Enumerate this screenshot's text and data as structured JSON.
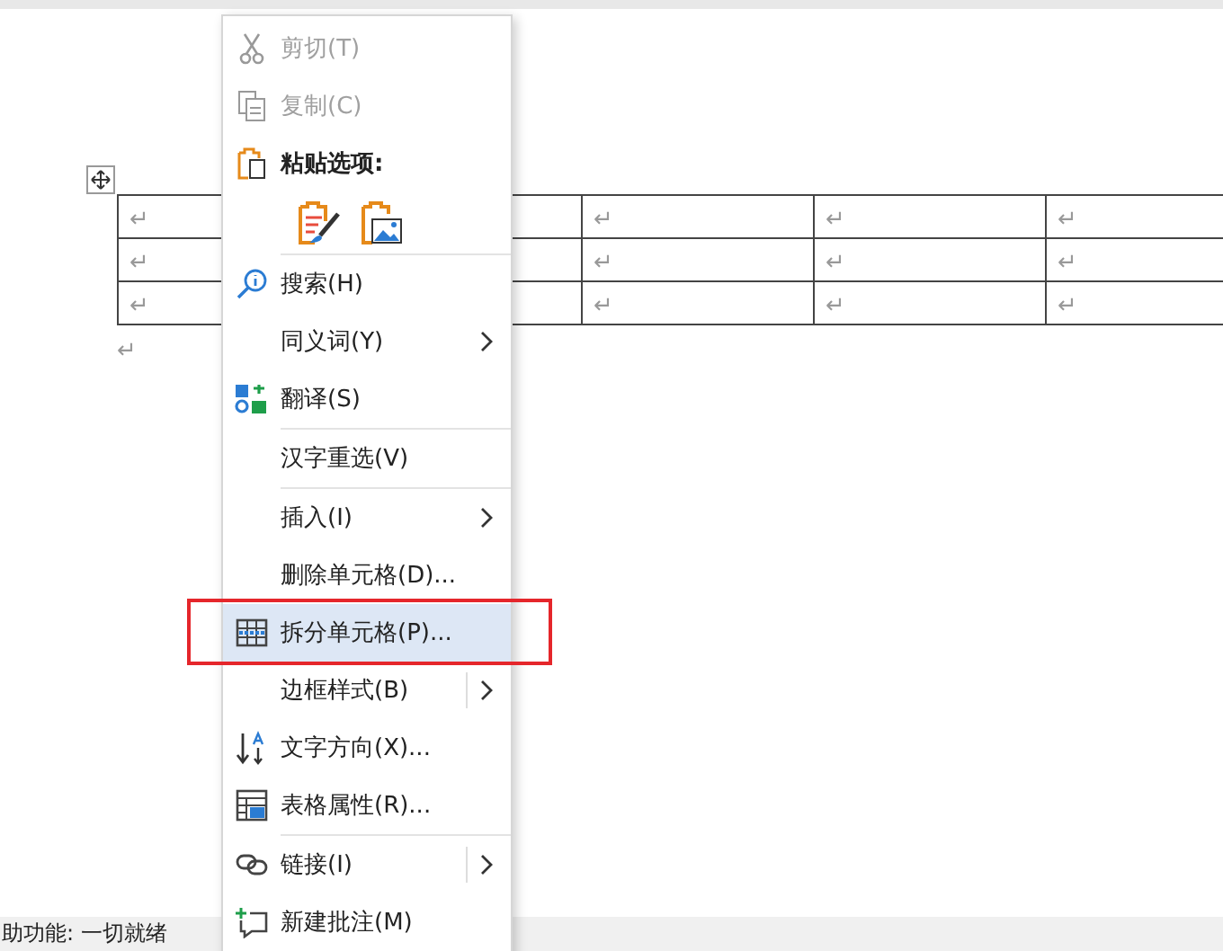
{
  "table": {
    "rows": [
      {
        "cells": [
          {
            "text": "↵"
          },
          {},
          {
            "text": "↵"
          },
          {
            "text": "↵"
          },
          {
            "text": "↵"
          }
        ]
      },
      {
        "cells": [
          {
            "text": "↵"
          },
          {},
          {
            "text": "↵"
          },
          {
            "text": "↵"
          },
          {
            "text": "↵"
          }
        ]
      },
      {
        "cells": [
          {
            "text": "↵"
          },
          {},
          {
            "text": "↵"
          },
          {
            "text": "↵"
          },
          {
            "text": "↵"
          }
        ]
      }
    ]
  },
  "paragraph_mark": "↵",
  "context_menu": {
    "items": [
      {
        "kind": "item",
        "label": "剪切(T)",
        "disabled": true,
        "submenu": false,
        "selected": false
      },
      {
        "kind": "item",
        "label": "复制(C)",
        "disabled": true,
        "submenu": false,
        "selected": false
      },
      {
        "kind": "header",
        "label": "粘贴选项:"
      },
      {
        "kind": "paste"
      },
      {
        "kind": "separator"
      },
      {
        "kind": "item",
        "label": "搜索(H)",
        "disabled": false,
        "submenu": false,
        "selected": false
      },
      {
        "kind": "item",
        "label": "同义词(Y)",
        "disabled": false,
        "submenu": true,
        "selected": false
      },
      {
        "kind": "item",
        "label": "翻译(S)",
        "disabled": false,
        "submenu": false,
        "selected": false
      },
      {
        "kind": "separator"
      },
      {
        "kind": "item",
        "label": "汉字重选(V)",
        "disabled": false,
        "submenu": false,
        "selected": false
      },
      {
        "kind": "separator"
      },
      {
        "kind": "item",
        "label": "插入(I)",
        "disabled": false,
        "submenu": true,
        "selected": false
      },
      {
        "kind": "item",
        "label": "删除单元格(D)...",
        "disabled": false,
        "submenu": false,
        "selected": false
      },
      {
        "kind": "item",
        "label": "拆分单元格(P)...",
        "disabled": false,
        "submenu": false,
        "selected": true,
        "annotated": true
      },
      {
        "kind": "item",
        "label": "边框样式(B)",
        "disabled": false,
        "submenu": true,
        "split": true,
        "selected": false
      },
      {
        "kind": "item",
        "label": "文字方向(X)...",
        "disabled": false,
        "submenu": false,
        "selected": false
      },
      {
        "kind": "item",
        "label": "表格属性(R)...",
        "disabled": false,
        "submenu": false,
        "selected": false
      },
      {
        "kind": "separator"
      },
      {
        "kind": "item",
        "label": "链接(I)",
        "disabled": false,
        "submenu": true,
        "split": true,
        "selected": false
      },
      {
        "kind": "item",
        "label": "新建批注(M)",
        "disabled": false,
        "submenu": false,
        "selected": false
      }
    ]
  },
  "status_bar": {
    "text": "助功能: 一切就绪"
  }
}
